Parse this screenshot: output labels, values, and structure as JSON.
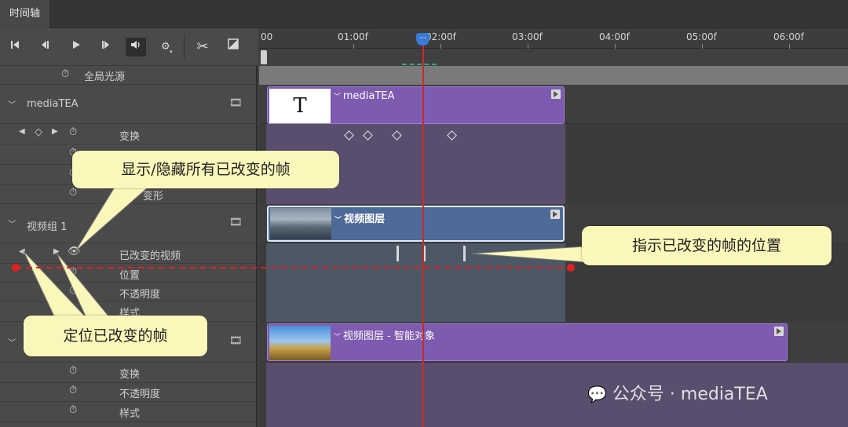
{
  "tab": {
    "label": "时间轴"
  },
  "toolbar": {
    "buttons": [
      {
        "name": "go-to-first-frame",
        "glyph": "⏮"
      },
      {
        "name": "previous-frame",
        "glyph": "◀‖"
      },
      {
        "name": "play",
        "glyph": "▶"
      },
      {
        "name": "next-frame",
        "glyph": "‖▶"
      },
      {
        "name": "audio",
        "glyph": "🔈"
      },
      {
        "name": "settings",
        "glyph": "⚙"
      },
      {
        "name": "split",
        "glyph": "✂"
      },
      {
        "name": "transition",
        "glyph": "◩"
      }
    ]
  },
  "ruler": {
    "ticks": [
      "00",
      "01:00f",
      "02:00f",
      "03:00f",
      "04:00f",
      "05:00f",
      "06:00f"
    ]
  },
  "layers": {
    "global_light": "全局光源",
    "mediatea": {
      "name": "mediaTEA",
      "props": [
        "变换",
        "",
        "",
        "变形"
      ]
    },
    "group1": {
      "name": "视频组 1",
      "props": [
        "已改变的视频",
        "位置",
        "不透明度",
        "样式"
      ]
    },
    "group2": {
      "props": [
        "变换",
        "不透明度",
        "样式"
      ]
    }
  },
  "clips": {
    "mediatea": {
      "label": "mediaTEA",
      "thumb_text": "T"
    },
    "video_layer": {
      "label": "视频图层"
    },
    "smart_object": {
      "label": "视频图层 - 智能对象"
    }
  },
  "callouts": {
    "show_hide": "显示/隐藏所有已改变的帧",
    "indicate": "指示已改变的帧的位置",
    "locate": "定位已改变的帧"
  },
  "watermark": "公众号 · mediaTEA",
  "colors": {
    "purple_clip": "#7d5bb0",
    "blue_clip": "#4e6a99",
    "callout": "#fbf6ba",
    "playhead": "#c92a2a",
    "arrow": "#e02020"
  }
}
